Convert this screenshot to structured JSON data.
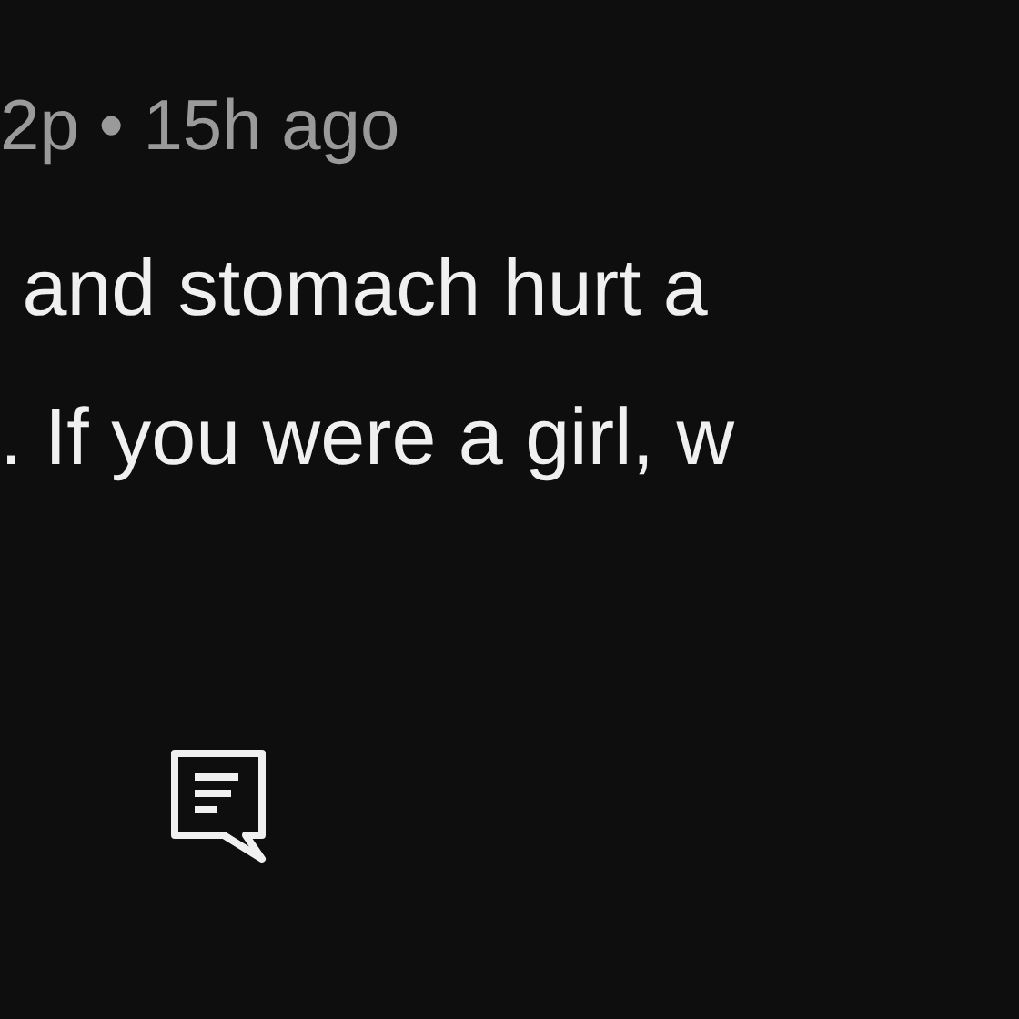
{
  "post_meta": "2p • 15h ago",
  "body_lines": [
    " and stomach hurt a",
    ". If you were a girl, w"
  ],
  "actions": [
    {
      "kind": "comment"
    }
  ]
}
